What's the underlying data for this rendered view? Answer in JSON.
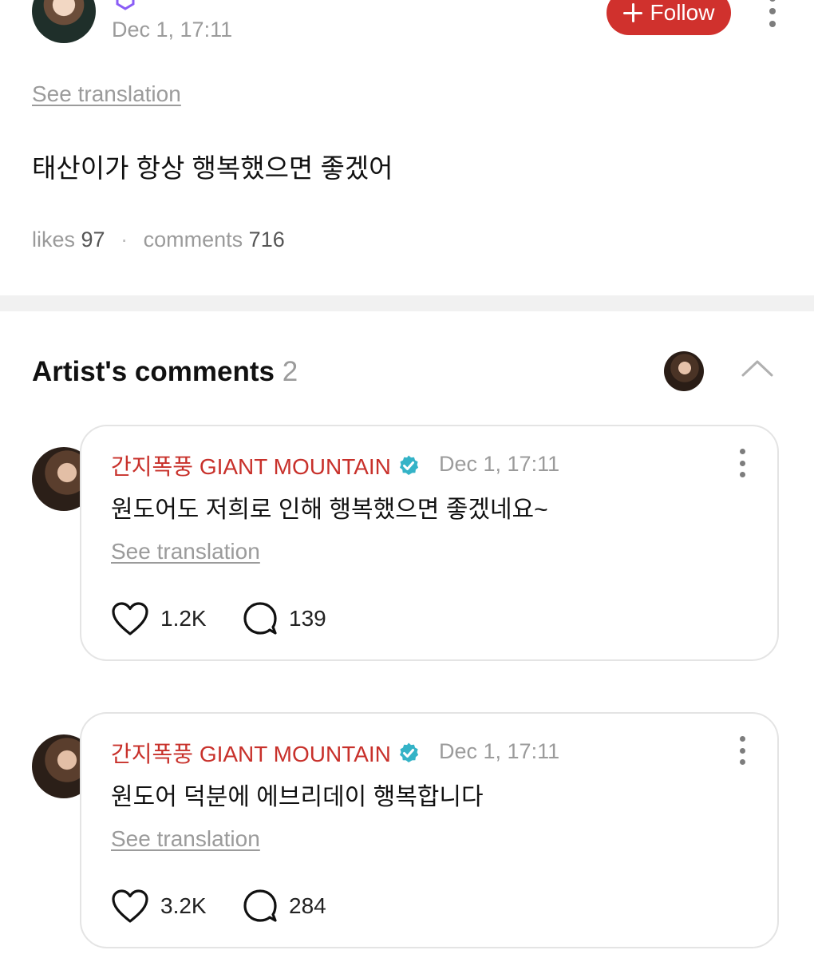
{
  "post": {
    "author": "",
    "date": "Dec 1, 17:11",
    "follow_label": "Follow",
    "see_translation": "See translation",
    "body": "태산이가 항상 행복했으면 좋겠어",
    "likes_label": "likes",
    "likes_count": "97",
    "comments_label": "comments",
    "comments_count": "716"
  },
  "artist_comments": {
    "title": "Artist's comments",
    "count": "2",
    "items": [
      {
        "author": "간지폭풍 GIANT MOUNTAIN",
        "date": "Dec 1, 17:11",
        "text": "원도어도 저희로 인해 행복했으면 좋겠네요~",
        "see_translation": "See translation",
        "likes": "1.2K",
        "replies": "139"
      },
      {
        "author": "간지폭풍 GIANT MOUNTAIN",
        "date": "Dec 1, 17:11",
        "text": "원도어 덕분에 에브리데이 행복합니다",
        "see_translation": "See translation",
        "likes": "3.2K",
        "replies": "284"
      }
    ]
  },
  "colors": {
    "accent": "#d0312d",
    "author_name": "#c8312b",
    "verified": "#34b3c7",
    "muted": "#9b9b9b"
  },
  "icons": [
    "more-vertical-icon",
    "plus-icon",
    "chevron-up-icon",
    "heart-icon",
    "comment-bubble-icon",
    "verified-badge-icon"
  ]
}
